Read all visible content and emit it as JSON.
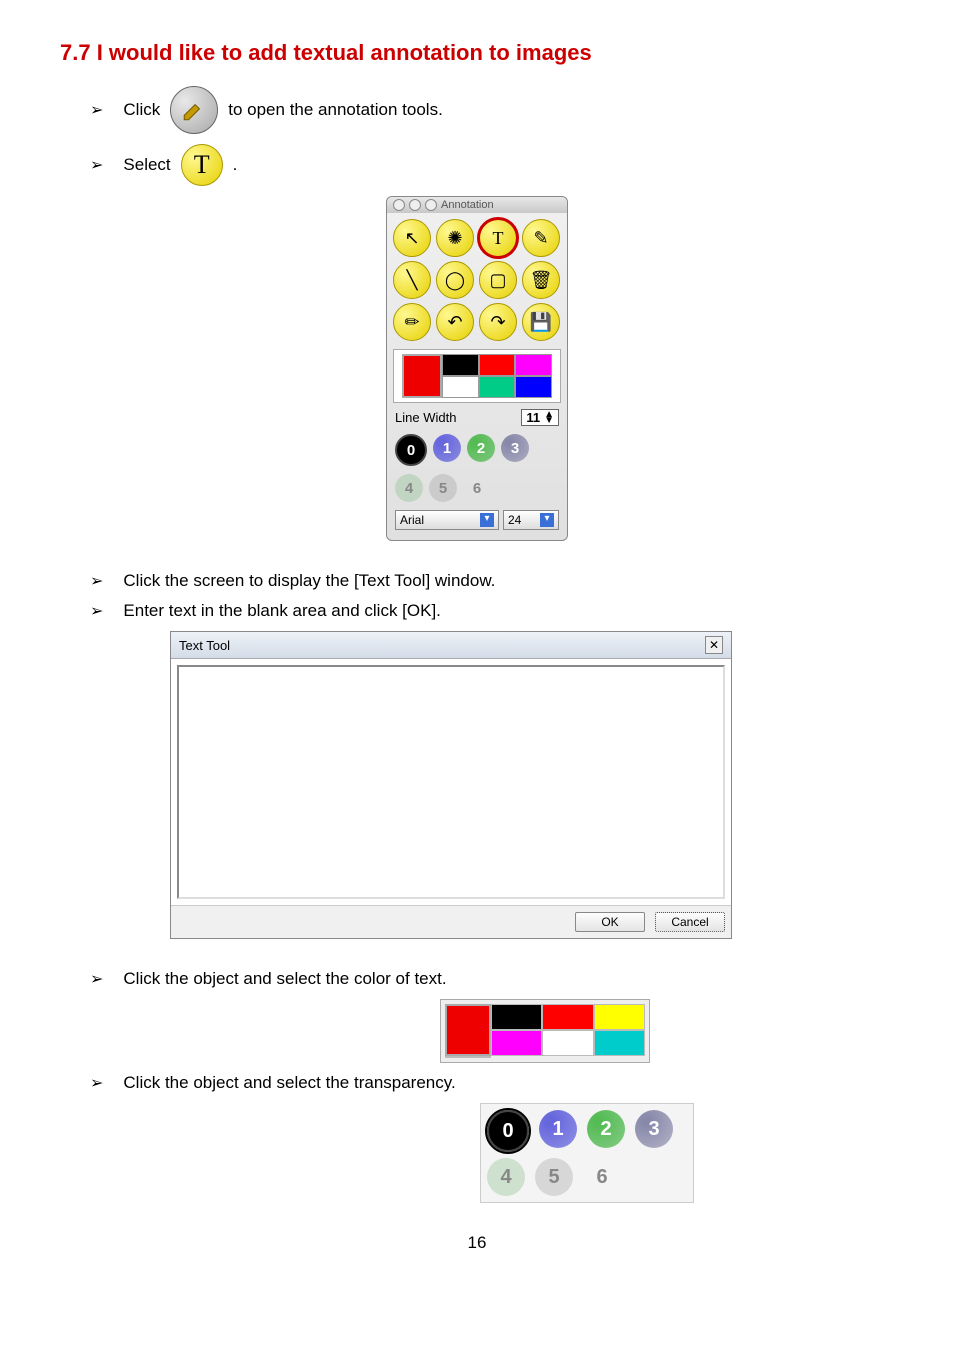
{
  "heading": "7.7  I would like to add textual annotation to images",
  "steps": {
    "s1a": "Click",
    "s1b": "to open the annotation tools.",
    "s2a": "Select",
    "s2b": ".",
    "s3": "Click the screen to display the [Text Tool] window.",
    "s4": "Enter text in the blank area and click [OK].",
    "s5": "Click the object and select the color of text.",
    "s6": "Click the object and select the transparency."
  },
  "panel": {
    "title": "Annotation",
    "text_glyph": "T",
    "line_width_label": "Line Width",
    "line_width_value": "11",
    "transparency": [
      "0",
      "1",
      "2",
      "3",
      "4",
      "5",
      "6"
    ],
    "font_name": "Arial",
    "font_size": "24"
  },
  "dialog": {
    "title": "Text Tool",
    "ok": "OK",
    "cancel": "Cancel"
  },
  "colors": {
    "current": "#e00000",
    "row1": [
      "#000000",
      "#ff0000",
      "#ffff00",
      "#ff00ff"
    ],
    "row2": [
      "#ffffff",
      "#00ff00",
      "#00cccc",
      "#0000ff"
    ]
  },
  "page_number": "16"
}
